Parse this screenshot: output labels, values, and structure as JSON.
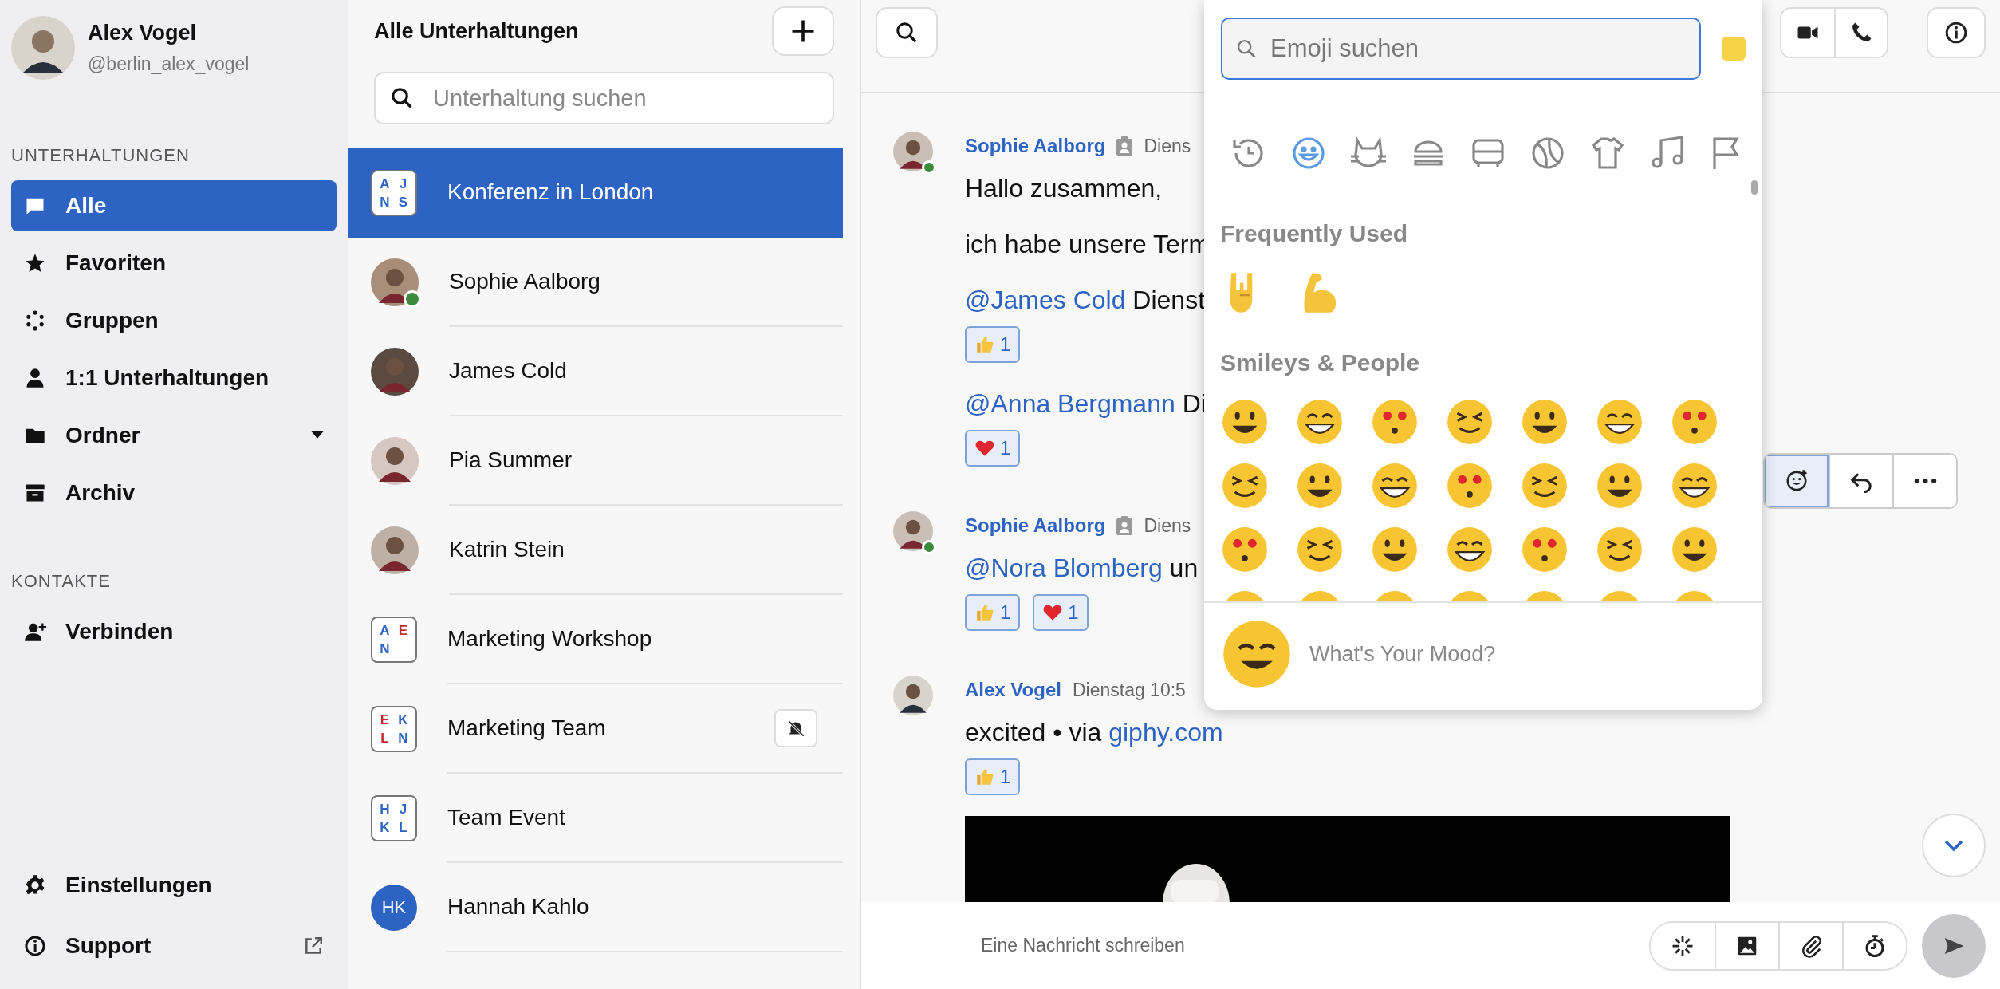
{
  "profile": {
    "name": "Alex Vogel",
    "handle": "@berlin_alex_vogel"
  },
  "nav_sections": [
    {
      "title": "UNTERHALTUNGEN",
      "items": [
        {
          "label": "Alle",
          "kind": "chat",
          "selected": true
        },
        {
          "label": "Favoriten",
          "kind": "star",
          "selected": false
        },
        {
          "label": "Gruppen",
          "kind": "groups",
          "selected": false
        },
        {
          "label": "1:1 Unterhaltungen",
          "kind": "person",
          "selected": false
        },
        {
          "label": "Ordner",
          "kind": "folder",
          "selected": false,
          "dropdown": true
        },
        {
          "label": "Archiv",
          "kind": "archive",
          "selected": false
        }
      ]
    },
    {
      "title": "KONTAKTE",
      "items": [
        {
          "label": "Verbinden",
          "kind": "connect",
          "selected": false
        }
      ]
    }
  ],
  "footer_nav": [
    {
      "label": "Einstellungen",
      "kind": "settings"
    },
    {
      "label": "Support",
      "kind": "info",
      "external": true
    }
  ],
  "conversations": {
    "title": "Alle Unterhaltungen",
    "search_placeholder": "Unterhaltung suchen",
    "items": [
      {
        "name": "Konferenz in London",
        "kind": "group",
        "selected": true,
        "muted": false,
        "letters": [
          {
            "text": "A",
            "color": "#2d64c3"
          },
          {
            "text": "J",
            "color": "#2d64c3"
          },
          {
            "text": "N",
            "color": "#2d64c3"
          },
          {
            "text": "S",
            "color": "#2d64c3"
          }
        ]
      },
      {
        "name": "Sophie Aalborg",
        "kind": "person",
        "selected": false,
        "muted": false,
        "online": true
      },
      {
        "name": "James Cold",
        "kind": "person",
        "selected": false,
        "muted": false,
        "online": false
      },
      {
        "name": "Pia Summer",
        "kind": "person",
        "selected": false,
        "muted": false,
        "online": false
      },
      {
        "name": "Katrin Stein",
        "kind": "person",
        "selected": false,
        "muted": false,
        "online": false
      },
      {
        "name": "Marketing Workshop",
        "kind": "group",
        "selected": false,
        "muted": false,
        "letters": [
          {
            "text": "A",
            "color": "#2d64c3"
          },
          {
            "text": "E",
            "color": "#c0282d"
          },
          {
            "text": "N",
            "color": "#2d64c3"
          }
        ]
      },
      {
        "name": "Marketing Team",
        "kind": "group",
        "selected": false,
        "muted": true,
        "letters": [
          {
            "text": "E",
            "color": "#c0282d"
          },
          {
            "text": "K",
            "color": "#2d64c3"
          },
          {
            "text": "L",
            "color": "#c0282d"
          },
          {
            "text": "N",
            "color": "#2d64c3"
          }
        ]
      },
      {
        "name": "Team Event",
        "kind": "group",
        "selected": false,
        "muted": false,
        "letters": [
          {
            "text": "H",
            "color": "#2d64c3"
          },
          {
            "text": "J",
            "color": "#2d64c3"
          },
          {
            "text": "K",
            "color": "#2d64c3"
          },
          {
            "text": "L",
            "color": "#2d64c3"
          }
        ]
      },
      {
        "name": "Hannah Kahlo",
        "kind": "initials",
        "selected": false,
        "muted": false,
        "initials": "HK"
      }
    ]
  },
  "messages": [
    {
      "author": "Sophie Aalborg",
      "time": "Diens",
      "online": true,
      "lines": [
        {
          "text": "Hallo zusammen,"
        },
        {
          "text": "ich habe unsere Term"
        },
        {
          "mention": "@James Cold",
          "text": "Dienst",
          "reactions": [
            {
              "kind": "thumbs",
              "count": "1"
            }
          ]
        },
        {
          "mention": "@Anna Bergmann",
          "text": "Di",
          "reactions": [
            {
              "kind": "heart",
              "count": "1"
            }
          ]
        }
      ]
    },
    {
      "author": "Sophie Aalborg",
      "time": "Diens",
      "online": true,
      "lines": [
        {
          "mention": "@Nora Blomberg",
          "text": "un",
          "reactions": [
            {
              "kind": "thumbs",
              "count": "1"
            },
            {
              "kind": "heart",
              "count": "1"
            }
          ]
        }
      ]
    },
    {
      "author": "Alex Vogel",
      "time": "Dienstag 10:5",
      "online": false,
      "lines": [
        {
          "text": "excited • via",
          "link": "giphy.com",
          "reactions": [
            {
              "kind": "thumbs",
              "count": "1"
            }
          ]
        }
      ],
      "kind": "picture"
    }
  ],
  "message_actions": [
    {
      "kind": "emoji",
      "selected": true
    },
    {
      "kind": "reply",
      "selected": false
    },
    {
      "kind": "more",
      "selected": false
    }
  ],
  "emoji_picker": {
    "search_placeholder": "Emoji suchen",
    "categories": [
      {
        "kind": "recent",
        "selected": false
      },
      {
        "kind": "smileys",
        "selected": true
      },
      {
        "kind": "animals",
        "selected": false
      },
      {
        "kind": "food",
        "selected": false
      },
      {
        "kind": "travel",
        "selected": false
      },
      {
        "kind": "activity",
        "selected": false
      },
      {
        "kind": "objects",
        "selected": false
      },
      {
        "kind": "symbols",
        "selected": false
      },
      {
        "kind": "flags",
        "selected": false
      }
    ],
    "sections": [
      {
        "title": "Frequently Used",
        "kind": "frequent"
      },
      {
        "title": "Smileys & People",
        "kind": "smileys"
      }
    ],
    "mood_prompt": "What's Your Mood?"
  },
  "composer": {
    "placeholder": "Eine Nachricht schreiben"
  }
}
